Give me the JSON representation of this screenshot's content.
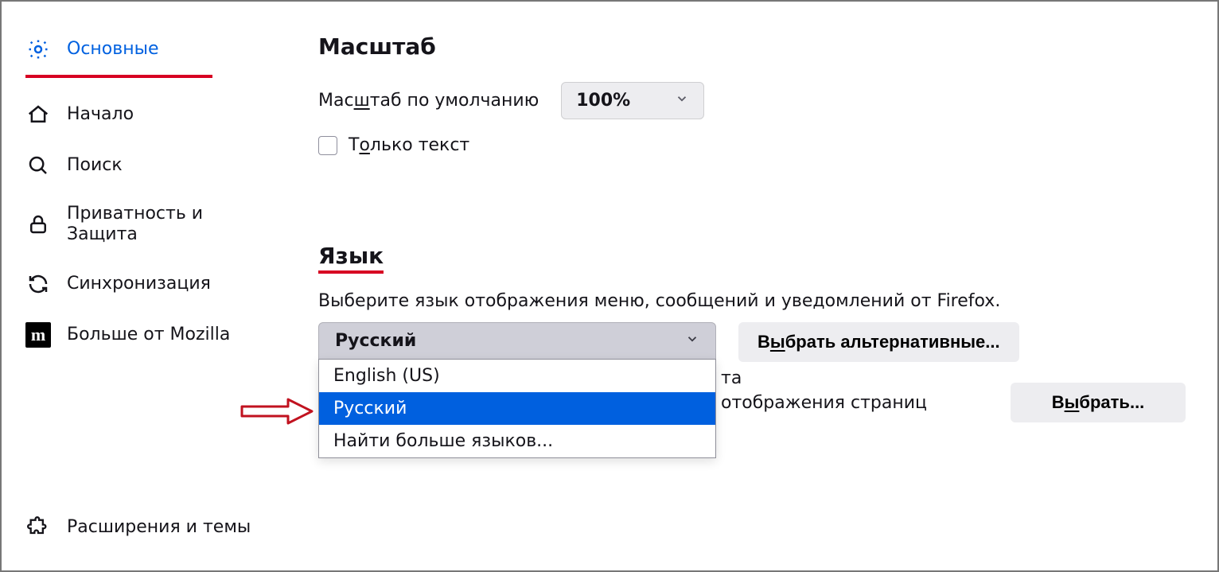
{
  "sidebar": {
    "items": [
      {
        "label": "Основные"
      },
      {
        "label": "Начало"
      },
      {
        "label": "Поиск"
      },
      {
        "label": "Приватность и Защита"
      },
      {
        "label": "Синхронизация"
      },
      {
        "label": "Больше от Mozilla"
      }
    ],
    "ext_label": "Расширения и темы"
  },
  "zoom": {
    "heading": "Масштаб",
    "default_label_pre": "Мас",
    "default_label_u": "ш",
    "default_label_post": "таб по умолчанию",
    "value": "100%",
    "text_only_pre": "Т",
    "text_only_u": "о",
    "text_only_post": "лько текст"
  },
  "language": {
    "heading": "Язык",
    "description": "Выберите язык отображения меню, сообщений и уведомлений от Firefox.",
    "selected": "Русский",
    "options": [
      "English (US)",
      "Русский",
      "Найти больше языков..."
    ],
    "alt_button_pre": "В",
    "alt_button_u": "ы",
    "alt_button_post": "брать альтернативные...",
    "pref_partial": "отображения страниц",
    "choose_btn_pre": "В",
    "choose_btn_u": "ы",
    "choose_btn_post": "брать...",
    "trailing_partial": "та"
  }
}
